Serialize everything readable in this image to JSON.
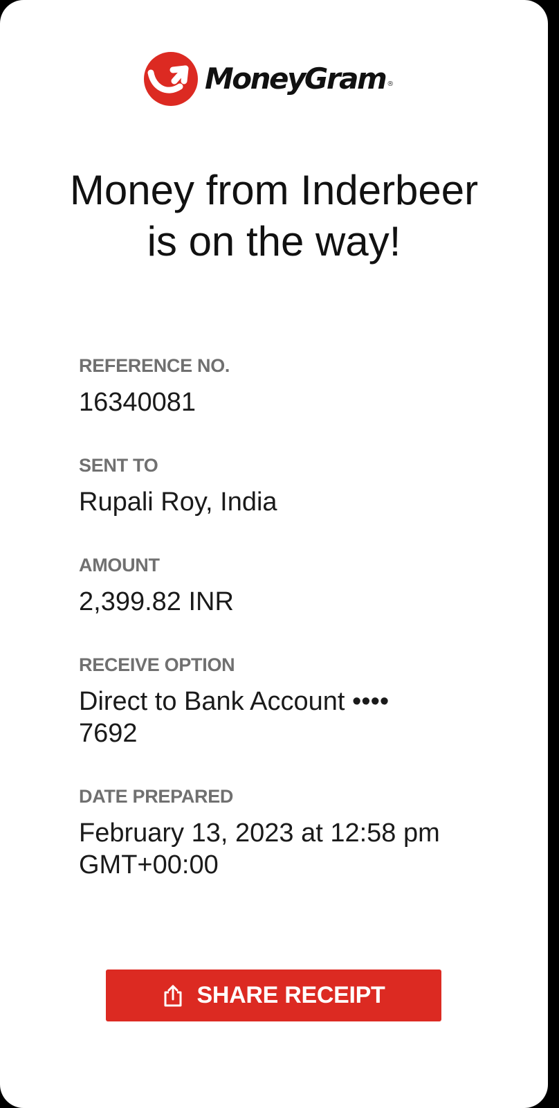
{
  "brand": {
    "name": "MoneyGram",
    "registered_mark": "®",
    "logo_icon": "moneygram-logo-icon",
    "accent_color": "#dc2a22"
  },
  "headline": "Money from Inderbeer is on the way!",
  "details": [
    {
      "label": "REFERENCE NO.",
      "value": "16340081"
    },
    {
      "label": "SENT TO",
      "value": "Rupali Roy, India"
    },
    {
      "label": "AMOUNT",
      "value": "2,399.82 INR"
    },
    {
      "label": "RECEIVE OPTION",
      "value": "Direct to Bank Account •••• 7692"
    },
    {
      "label": "DATE PREPARED",
      "value": "February 13, 2023 at 12:58 pm GMT+00:00"
    }
  ],
  "actions": {
    "share_label": "SHARE RECEIPT",
    "share_icon": "share-icon"
  }
}
